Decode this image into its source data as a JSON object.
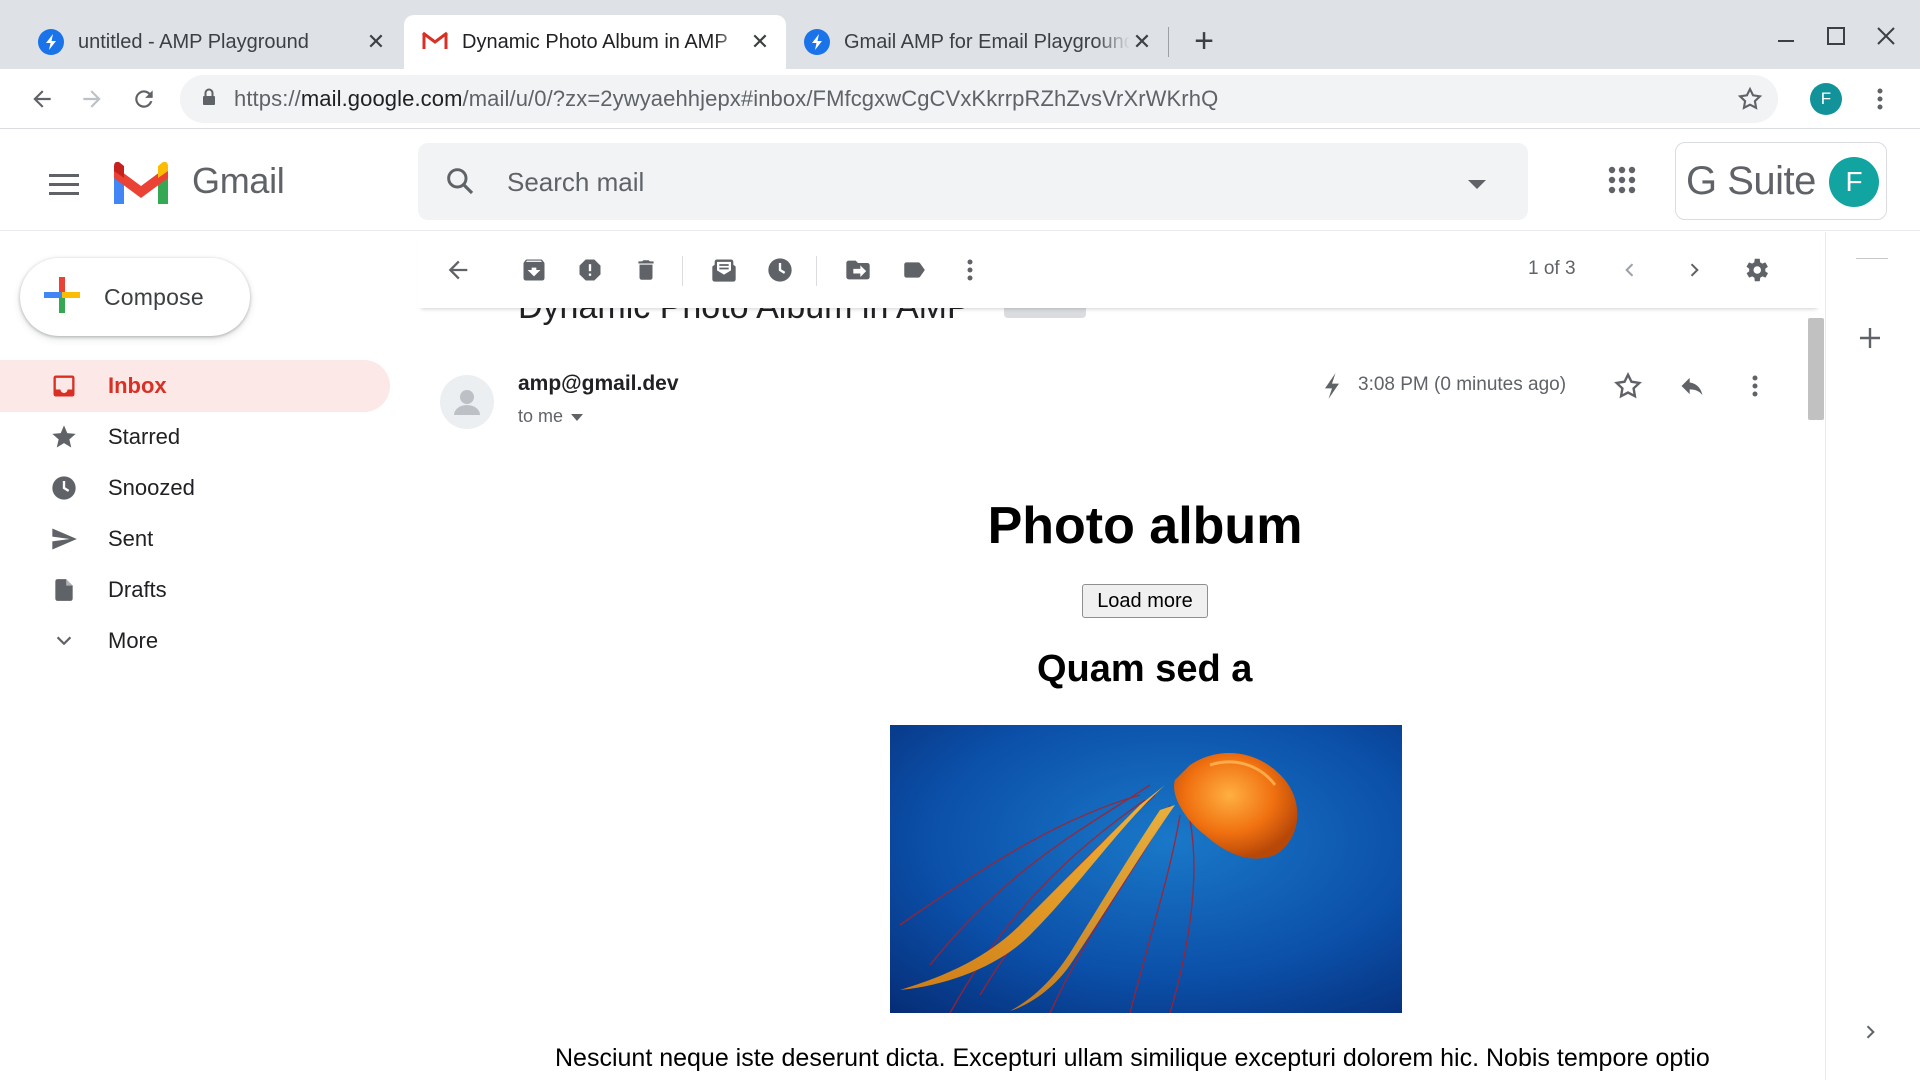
{
  "browser": {
    "tabs": [
      {
        "title": "untitled - AMP Playground",
        "favicon": "amp-icon",
        "active": false
      },
      {
        "title": "Dynamic Photo Album in AMP",
        "favicon": "gmail-icon",
        "active": true
      },
      {
        "title": "Gmail AMP for Email Playground",
        "favicon": "amp-icon",
        "active": false
      }
    ],
    "url_host_prefix": "https://",
    "url_host": "mail.google.com",
    "url_path": "/mail/u/0/?zx=2ywyaehhjepx#inbox/FMfcgxwCgCVxKkrrpRZhZvsVrXrWKrhQ",
    "profile_initial": "F"
  },
  "gmail": {
    "product_name": "Gmail",
    "search_placeholder": "Search mail",
    "gsuite_label": "G Suite",
    "account_initial": "F",
    "compose_label": "Compose",
    "nav": [
      {
        "label": "Inbox",
        "icon": "inbox-icon",
        "selected": true
      },
      {
        "label": "Starred",
        "icon": "star-icon",
        "selected": false
      },
      {
        "label": "Snoozed",
        "icon": "clock-icon",
        "selected": false
      },
      {
        "label": "Sent",
        "icon": "send-icon",
        "selected": false
      },
      {
        "label": "Drafts",
        "icon": "draft-icon",
        "selected": false
      },
      {
        "label": "More",
        "icon": "chevron-down-icon",
        "selected": false
      }
    ],
    "toolbar": {
      "page_count": "1 of 3"
    }
  },
  "message": {
    "subject": "Dynamic Photo Album in AMP",
    "sender": "amp@gmail.dev",
    "recipient": "to me",
    "time": "3:08 PM (0 minutes ago)"
  },
  "email_body": {
    "album_title": "Photo album",
    "load_more_label": "Load more",
    "photo_title": "Quam sed a",
    "photo_subject": "orange jellyfish on deep blue water",
    "caption": "Nesciunt neque iste deserunt dicta. Excepturi ullam similique excepturi dolorem hic. Nobis tempore optio"
  },
  "colors": {
    "gmail_red": "#d93025",
    "selected_nav_bg": "#fce8e6",
    "chrome_tabbar": "#dee1e6",
    "accent_blue": "#1a73e8",
    "avatar_teal": "#12a4a0"
  }
}
